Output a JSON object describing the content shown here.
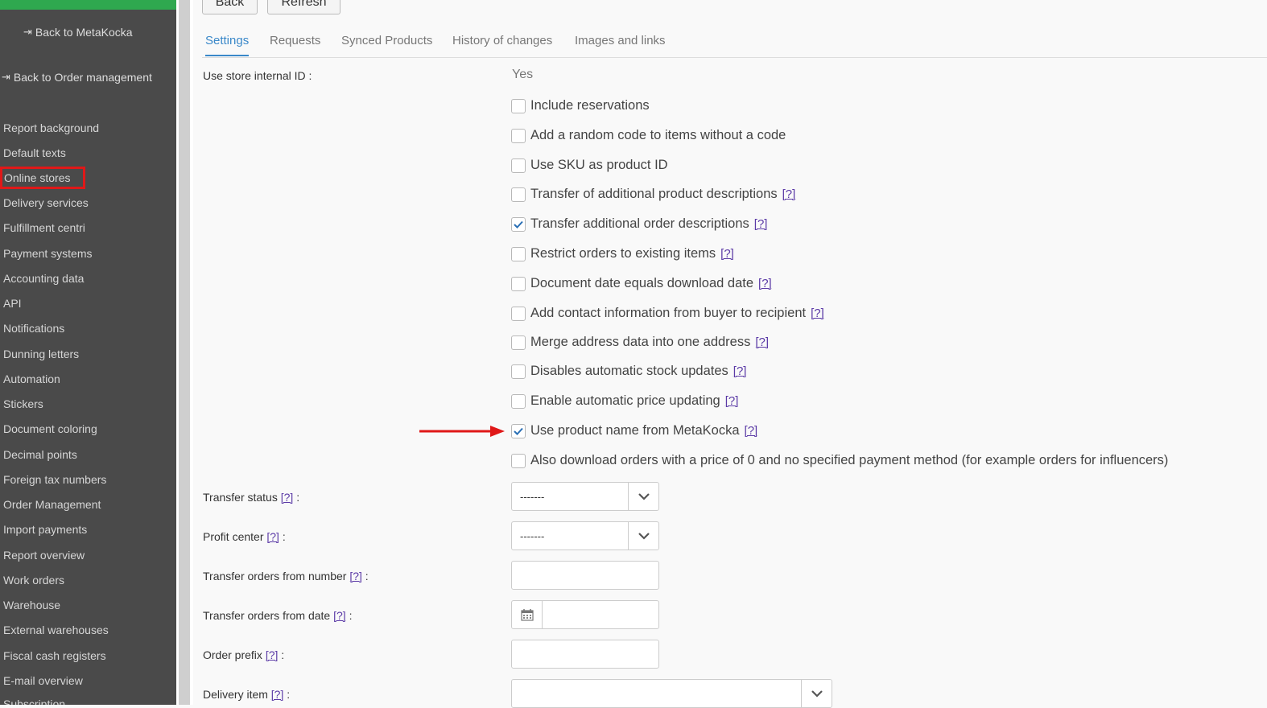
{
  "sidebar": {
    "back_metakocka": "Back to MetaKocka",
    "back_order_mgmt": "Back to Order management",
    "items": [
      "Report background",
      "Default texts",
      "Online stores",
      "Delivery services",
      "Fulfillment centri",
      "Payment systems",
      "Accounting data",
      "API",
      "Notifications",
      "Dunning letters",
      "Automation",
      "Stickers",
      "Document coloring",
      "Decimal points",
      "Foreign tax numbers",
      "Order Management",
      "Import payments",
      "Report overview",
      "Work orders",
      "Warehouse",
      "External warehouses",
      "Fiscal cash registers",
      "E-mail overview",
      "Subscription"
    ],
    "highlighted": "Online stores"
  },
  "toolbar": {
    "back": "Back",
    "refresh": "Refresh"
  },
  "tabs": [
    "Settings",
    "Requests",
    "Synced Products",
    "History of changes",
    "Images and links"
  ],
  "active_tab": "Settings",
  "form": {
    "store_id_label": "Use store internal ID :",
    "store_id_value": "Yes",
    "help": "[?]",
    "checkboxes": [
      {
        "label": "Include reservations",
        "checked": false,
        "help": false
      },
      {
        "label": "Add a random code to items without a code",
        "checked": false,
        "help": false
      },
      {
        "label": "Use SKU as product ID",
        "checked": false,
        "help": false
      },
      {
        "label": "Transfer of additional product descriptions",
        "checked": false,
        "help": true
      },
      {
        "label": "Transfer additional order descriptions",
        "checked": true,
        "help": true
      },
      {
        "label": "Restrict orders to existing items",
        "checked": false,
        "help": true
      },
      {
        "label": "Document date equals download date",
        "checked": false,
        "help": true
      },
      {
        "label": "Add contact information from buyer to recipient",
        "checked": false,
        "help": true
      },
      {
        "label": "Merge address data into one address",
        "checked": false,
        "help": true
      },
      {
        "label": "Disables automatic stock updates",
        "checked": false,
        "help": true
      },
      {
        "label": "Enable automatic price updating",
        "checked": false,
        "help": true
      },
      {
        "label": "Use product name from MetaKocka",
        "checked": true,
        "help": true
      },
      {
        "label": "Also download orders with a price of 0 and no specified payment method (for example orders for influencers)",
        "checked": false,
        "help": false
      }
    ],
    "transfer_status_label": "Transfer status",
    "transfer_status_value": "-------",
    "profit_center_label": "Profit center",
    "profit_center_value": "-------",
    "from_number_label": "Transfer orders from number",
    "from_date_label": "Transfer orders from date",
    "order_prefix_label": "Order prefix",
    "delivery_item_label": "Delivery item",
    "colon": ":"
  },
  "colors": {
    "accent": "#3a88c9",
    "sidebar_bg": "#4a4a4a",
    "topbar": "#2fa84f",
    "annotation": "#e01818",
    "help_link": "#5b3aa6"
  }
}
